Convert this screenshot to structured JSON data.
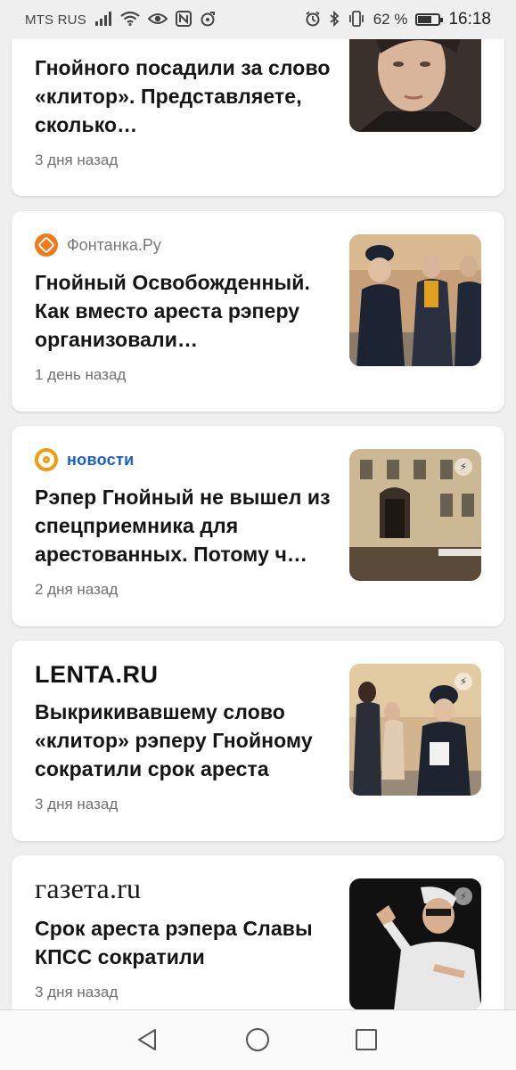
{
  "status_bar": {
    "carrier": "MTS RUS",
    "battery": "62 %",
    "battery_level": 0.62,
    "time": "16:18"
  },
  "feed": [
    {
      "source": "",
      "headline": "Гнойного посадили за слово «клитор». Представляете, сколько…",
      "time_ago": "3 дня назад",
      "thumbnail": "portrait-young-man",
      "colors": [
        "#2a2220",
        "#d9b59b"
      ]
    },
    {
      "source": "Фонтанка.Ру",
      "headline": "Гнойный Освобожденный. Как вместо ареста рэперу организовали…",
      "time_ago": "1 день назад",
      "thumbnail": "police-escort-street",
      "colors": [
        "#c7a07a",
        "#1c2433"
      ]
    },
    {
      "source": "новости",
      "headline": "Рэпер Гнойный не вышел из спецприемника для арестованных. Потому ч…",
      "time_ago": "2 дня назад",
      "thumbnail": "building-facade",
      "colors": [
        "#b9a98a",
        "#5a4a3a"
      ]
    },
    {
      "source": "LENTA.RU",
      "headline": "Выкрикивавшему слово «клитор» рэперу Гнойному сократили срок ареста",
      "time_ago": "3 дня назад",
      "thumbnail": "police-walking-street",
      "colors": [
        "#d2b58e",
        "#1e2330"
      ]
    },
    {
      "source": "газета.ru",
      "headline": "Срок ареста рэпера Славы КПСС сократили",
      "time_ago": "3 дня назад",
      "thumbnail": "rapper-gesture",
      "colors": [
        "#111111",
        "#e8e8e8"
      ]
    }
  ]
}
